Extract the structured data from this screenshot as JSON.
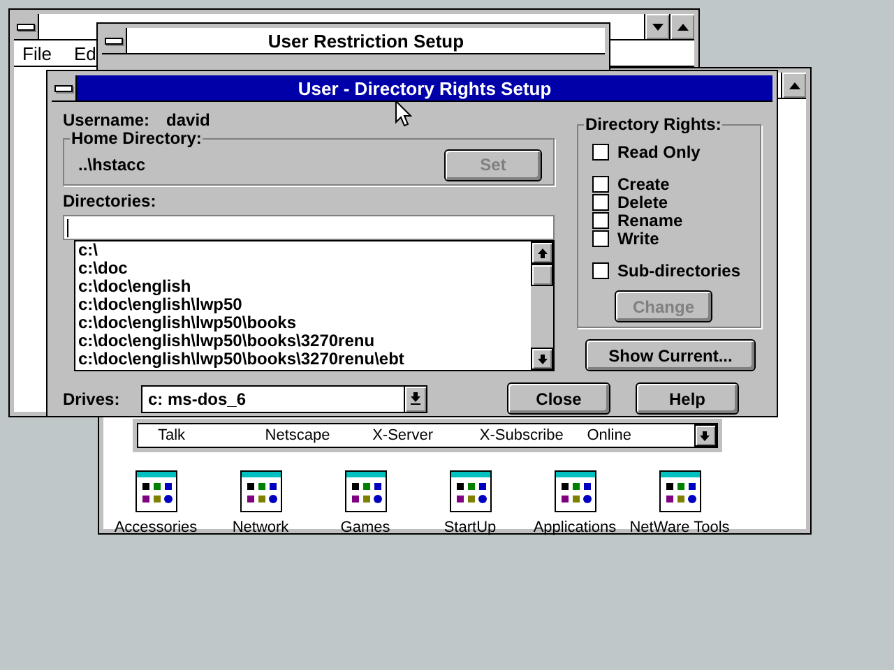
{
  "session_window": {
    "menu": [
      "File",
      "Ed"
    ]
  },
  "restriction_window": {
    "title": "User Restriction Setup"
  },
  "group_window": {
    "program_items": [
      "Talk",
      "Netscape",
      "X-Server",
      "X-Subscribe",
      "Online"
    ],
    "groups": [
      "Accessories",
      "Network",
      "Games",
      "StartUp",
      "Applications",
      "NetWare Tools"
    ]
  },
  "dialog": {
    "title": "User - Directory Rights Setup",
    "username_label": "Username:",
    "username": "david",
    "home_directory": {
      "label": "Home Directory:",
      "value": "..\\hstacc",
      "set_button": {
        "label": "Set",
        "disabled": true
      }
    },
    "directories_label": "Directories:",
    "directories": [
      "c:\\",
      "c:\\doc",
      "c:\\doc\\english",
      "c:\\doc\\english\\lwp50",
      "c:\\doc\\english\\lwp50\\books",
      "c:\\doc\\english\\lwp50\\books\\3270renu",
      "c:\\doc\\english\\lwp50\\books\\3270renu\\ebt"
    ],
    "drives_label": "Drives:",
    "drive": "c: ms-dos_6",
    "rights": {
      "title": "Directory Rights:",
      "groups": [
        [
          {
            "label": "Read Only",
            "checked": false
          }
        ],
        [
          {
            "label": "Create",
            "checked": false
          },
          {
            "label": "Delete",
            "checked": false
          },
          {
            "label": "Rename",
            "checked": false
          },
          {
            "label": "Write",
            "checked": false
          }
        ],
        [
          {
            "label": "Sub-directories",
            "checked": false
          }
        ]
      ],
      "change_button": {
        "label": "Change",
        "disabled": true
      }
    },
    "show_current_button": {
      "label": "Show Current...",
      "disabled": false
    },
    "buttons": [
      {
        "label": "Close",
        "disabled": false
      },
      {
        "label": "Help",
        "disabled": false
      }
    ]
  }
}
